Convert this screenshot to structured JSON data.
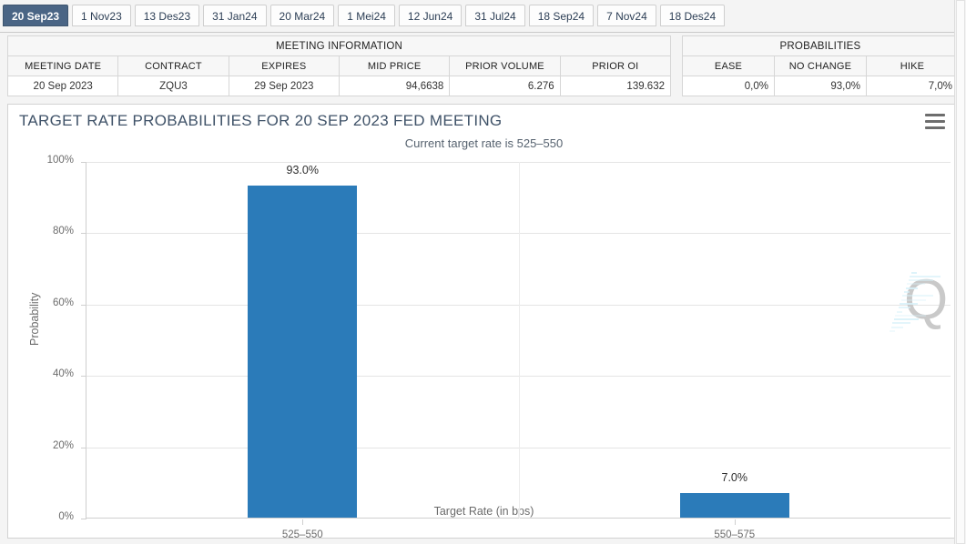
{
  "tabs": [
    {
      "label": "20 Sep23",
      "active": true
    },
    {
      "label": "1 Nov23",
      "active": false
    },
    {
      "label": "13 Des23",
      "active": false
    },
    {
      "label": "31 Jan24",
      "active": false
    },
    {
      "label": "20 Mar24",
      "active": false
    },
    {
      "label": "1 Mei24",
      "active": false
    },
    {
      "label": "12 Jun24",
      "active": false
    },
    {
      "label": "31 Jul24",
      "active": false
    },
    {
      "label": "18 Sep24",
      "active": false
    },
    {
      "label": "7 Nov24",
      "active": false
    },
    {
      "label": "18 Des24",
      "active": false
    }
  ],
  "meeting_table": {
    "title": "MEETING INFORMATION",
    "headers": [
      "MEETING DATE",
      "CONTRACT",
      "EXPIRES",
      "MID PRICE",
      "PRIOR VOLUME",
      "PRIOR OI"
    ],
    "row": [
      "20 Sep 2023",
      "ZQU3",
      "29 Sep 2023",
      "94,6638",
      "6.276",
      "139.632"
    ]
  },
  "probabilities_table": {
    "title": "PROBABILITIES",
    "headers": [
      "EASE",
      "NO CHANGE",
      "HIKE"
    ],
    "row": [
      "0,0%",
      "93,0%",
      "7,0%"
    ]
  },
  "chart": {
    "title": "TARGET RATE PROBABILITIES FOR 20 SEP 2023 FED MEETING",
    "subtitle": "Current target rate is 525–550",
    "menu_icon": "hamburger-menu-icon",
    "watermark": "Q"
  },
  "chart_data": {
    "type": "bar",
    "title": "TARGET RATE PROBABILITIES FOR 20 SEP 2023 FED MEETING",
    "subtitle": "Current target rate is 525–550",
    "categories": [
      "525–550",
      "550–575"
    ],
    "values": [
      93.0,
      7.0
    ],
    "data_labels": [
      "93.0%",
      "7.0%"
    ],
    "xlabel": "Target Rate (in bps)",
    "ylabel": "Probability",
    "ylim": [
      0,
      100
    ],
    "yticks": [
      0,
      20,
      40,
      60,
      80,
      100
    ],
    "ytick_labels": [
      "0%",
      "20%",
      "40%",
      "60%",
      "80%",
      "100%"
    ],
    "grid": true,
    "legend": false,
    "bar_color": "#2b7bb9"
  },
  "colors": {
    "accent": "#2b7bb9",
    "active_tab": "#4a6585",
    "title_text": "#3f5268",
    "grid": "#e4e4e4"
  }
}
